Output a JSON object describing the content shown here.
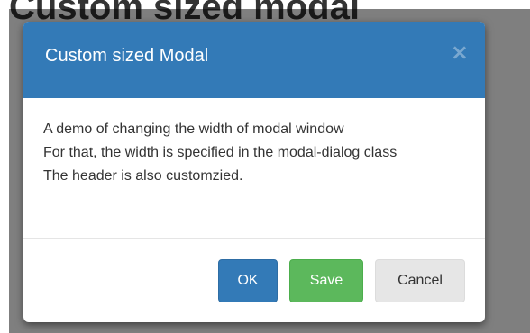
{
  "background": {
    "heading": "Custom sized modal"
  },
  "modal": {
    "title": "Custom sized Modal",
    "close_symbol": "×",
    "body_lines": [
      "A demo of changing the width of modal window",
      "For that, the width is specified in the modal-dialog class",
      "The header is also customzied."
    ],
    "buttons": {
      "ok": "OK",
      "save": "Save",
      "cancel": "Cancel"
    }
  },
  "colors": {
    "header": "#337ab7",
    "primary": "#337ab7",
    "success": "#5cb85c",
    "default": "#e6e6e6"
  }
}
